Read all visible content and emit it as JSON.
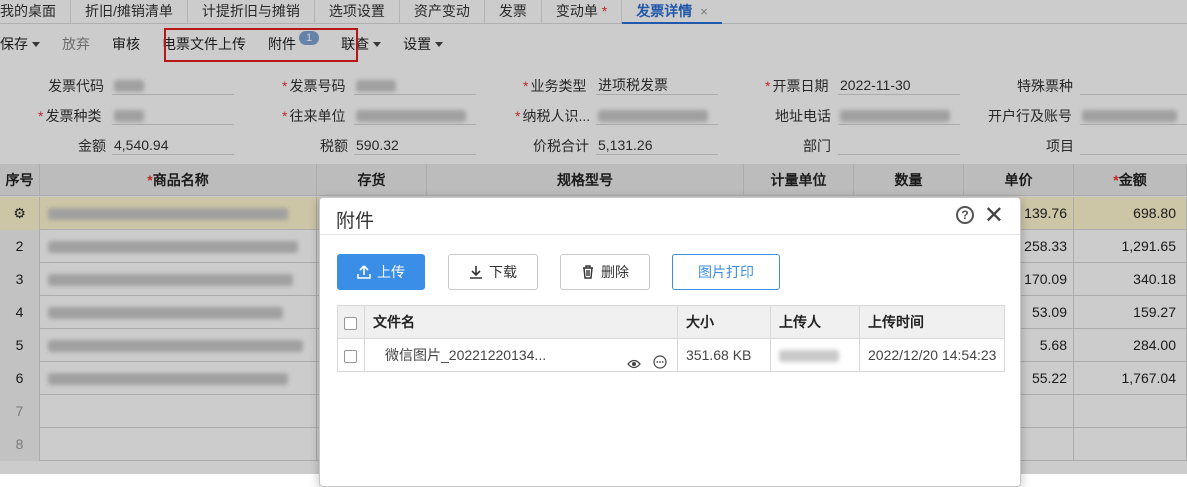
{
  "tabs": [
    {
      "label": "我的桌面",
      "active": false,
      "modified": false
    },
    {
      "label": "折旧/摊销清单",
      "active": false,
      "modified": false
    },
    {
      "label": "计提折旧与摊销",
      "active": false,
      "modified": false
    },
    {
      "label": "选项设置",
      "active": false,
      "modified": false
    },
    {
      "label": "资产变动",
      "active": false,
      "modified": false
    },
    {
      "label": "发票",
      "active": false,
      "modified": false
    },
    {
      "label": "变动单",
      "active": false,
      "modified": true,
      "marker": "*"
    },
    {
      "label": "发票详情",
      "active": true,
      "modified": false,
      "close": "×"
    }
  ],
  "toolbar": {
    "save": "保存",
    "discard": "放弃",
    "audit": "审核",
    "upload_einvoice": "电票文件上传",
    "attachments": "附件",
    "attachments_count": "1",
    "linked_query": "联查",
    "settings": "设置"
  },
  "form": {
    "invoice_code_label": "发票代码",
    "invoice_number_label": "发票号码",
    "business_type_label": "业务类型",
    "business_type_value": "进项税发票",
    "issue_date_label": "开票日期",
    "issue_date_value": "2022-11-30",
    "special_type_label": "特殊票种",
    "invoice_type_label": "发票种类",
    "counterparty_label": "往来单位",
    "taxpayer_id_label": "纳税人识...",
    "address_phone_label": "地址电话",
    "bank_account_label": "开户行及账号",
    "amount_label": "金额",
    "amount_value": "4,540.94",
    "tax_label": "税额",
    "tax_value": "590.32",
    "total_label": "价税合计",
    "total_value": "5,131.26",
    "department_label": "部门",
    "project_label": "项目",
    "required_marker": "*"
  },
  "grid": {
    "headers": {
      "seq": "序号",
      "name": "商品名称",
      "inventory": "存货",
      "spec": "规格型号",
      "unit": "计量单位",
      "qty": "数量",
      "price": "单价",
      "amount": "金额"
    },
    "rows": [
      {
        "seq": "⚙",
        "price": "139.76",
        "amount": "698.80",
        "selected": true
      },
      {
        "seq": "2",
        "price": "258.33",
        "amount": "1,291.65",
        "selected": false
      },
      {
        "seq": "3",
        "price": "170.09",
        "amount": "340.18",
        "selected": false
      },
      {
        "seq": "4",
        "price": "53.09",
        "amount": "159.27",
        "selected": false
      },
      {
        "seq": "5",
        "price": "5.68",
        "amount": "284.00",
        "selected": false
      },
      {
        "seq": "6",
        "price": "55.22",
        "amount": "1,767.04",
        "selected": false
      },
      {
        "seq": "7",
        "price": "",
        "amount": "",
        "selected": false
      },
      {
        "seq": "8",
        "price": "",
        "amount": "",
        "selected": false
      }
    ]
  },
  "dialog": {
    "title": "附件",
    "help": "?",
    "close": "✕",
    "buttons": {
      "upload": "上传",
      "download": "下载",
      "delete": "删除",
      "print_image": "图片打印"
    },
    "table": {
      "headers": {
        "filename": "文件名",
        "size": "大小",
        "uploader": "上传人",
        "upload_time": "上传时间"
      },
      "rows": [
        {
          "filename": "微信图片_20221220134...",
          "size": "351.68 KB",
          "upload_time": "2022/12/20 14:54:23"
        }
      ]
    }
  },
  "colors": {
    "accent": "#3a8ee6",
    "tab_active": "#2b6fd6",
    "highlight_box": "#e51c1c",
    "required": "#e33333",
    "selected_row": "#fff7d0"
  }
}
